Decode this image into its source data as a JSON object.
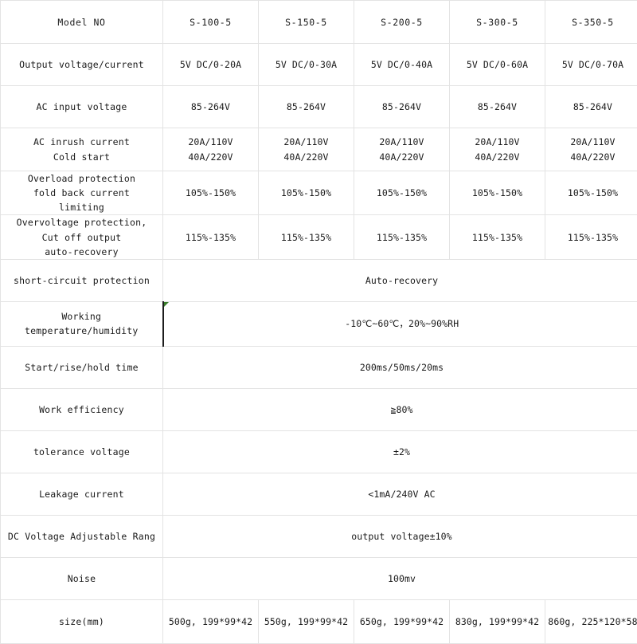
{
  "table": {
    "title_cell": "Model NO",
    "models": [
      "S-100-5",
      "S-150-5",
      "S-200-5",
      "S-300-5",
      "S-350-5"
    ],
    "colors": {
      "border": "#e3e3e3",
      "text": "#1a1a1a",
      "background": "#ffffff",
      "flag_green": "#3a7d2c",
      "selected_border": "#1d1d1d"
    },
    "rows": [
      {
        "label": "Output voltage/current",
        "label_lines": [
          "Output voltage/current"
        ],
        "type": "per-model",
        "values": [
          "5V DC/0-20A",
          "5V DC/0-30A",
          "5V DC/0-40A",
          "5V DC/0-60A",
          "5V DC/0-70A"
        ]
      },
      {
        "label": "AC input voltage",
        "label_lines": [
          "AC input voltage"
        ],
        "type": "per-model",
        "values": [
          "85-264V",
          "85-264V",
          "85-264V",
          "85-264V",
          "85-264V"
        ]
      },
      {
        "label": "AC inrush current Cold start",
        "label_lines": [
          "AC inrush current",
          "Cold start"
        ],
        "type": "per-model",
        "value_lines": [
          [
            "20A/110V",
            "40A/220V"
          ],
          [
            "20A/110V",
            "40A/220V"
          ],
          [
            "20A/110V",
            "40A/220V"
          ],
          [
            "20A/110V",
            "40A/220V"
          ],
          [
            "20A/110V",
            "40A/220V"
          ]
        ]
      },
      {
        "label": "Overload protection fold back current limiting",
        "label_lines": [
          "Overload protection",
          "fold back current",
          "limiting"
        ],
        "type": "per-model",
        "values": [
          "105%-150%",
          "105%-150%",
          "105%-150%",
          "105%-150%",
          "105%-150%"
        ]
      },
      {
        "label": "Overvoltage protection, Cut off output auto-recovery",
        "label_lines": [
          "Overvoltage protection,",
          "Cut off output",
          "auto-recovery"
        ],
        "type": "per-model",
        "values": [
          "115%-135%",
          "115%-135%",
          "115%-135%",
          "115%-135%",
          "115%-135%"
        ]
      },
      {
        "label": "short-circuit protection",
        "label_lines": [
          "short-circuit protection"
        ],
        "type": "merged",
        "value": "Auto-recovery"
      },
      {
        "label": "Working temperature/humidity",
        "label_lines": [
          "Working",
          "temperature/humidity"
        ],
        "type": "merged-flagged",
        "value": "-10℃~60℃，20%~90%RH"
      },
      {
        "label": "Start/rise/hold time",
        "label_lines": [
          "Start/rise/hold time"
        ],
        "type": "merged",
        "value": "200ms/50ms/20ms"
      },
      {
        "label": "Work efficiency",
        "label_lines": [
          "Work efficiency"
        ],
        "type": "merged",
        "value": "≧80%"
      },
      {
        "label": "tolerance voltage",
        "label_lines": [
          "tolerance voltage"
        ],
        "type": "merged",
        "value": "±2%"
      },
      {
        "label": "Leakage current",
        "label_lines": [
          "Leakage current"
        ],
        "type": "merged",
        "value": "<1mA/240V AC"
      },
      {
        "label": "DC Voltage Adjustable Rang",
        "label_lines": [
          "DC Voltage Adjustable Rang"
        ],
        "type": "merged-overflow",
        "value": "output voltage±10%"
      },
      {
        "label": "Noise",
        "label_lines": [
          "Noise"
        ],
        "type": "merged",
        "value": "100mv"
      },
      {
        "label": "size(mm)",
        "label_lines": [
          "size(mm)"
        ],
        "type": "per-model",
        "values": [
          "500g, 199*99*42",
          "550g, 199*99*42",
          "650g, 199*99*42",
          "830g, 199*99*42",
          "860g, 225*120*58"
        ]
      }
    ]
  }
}
